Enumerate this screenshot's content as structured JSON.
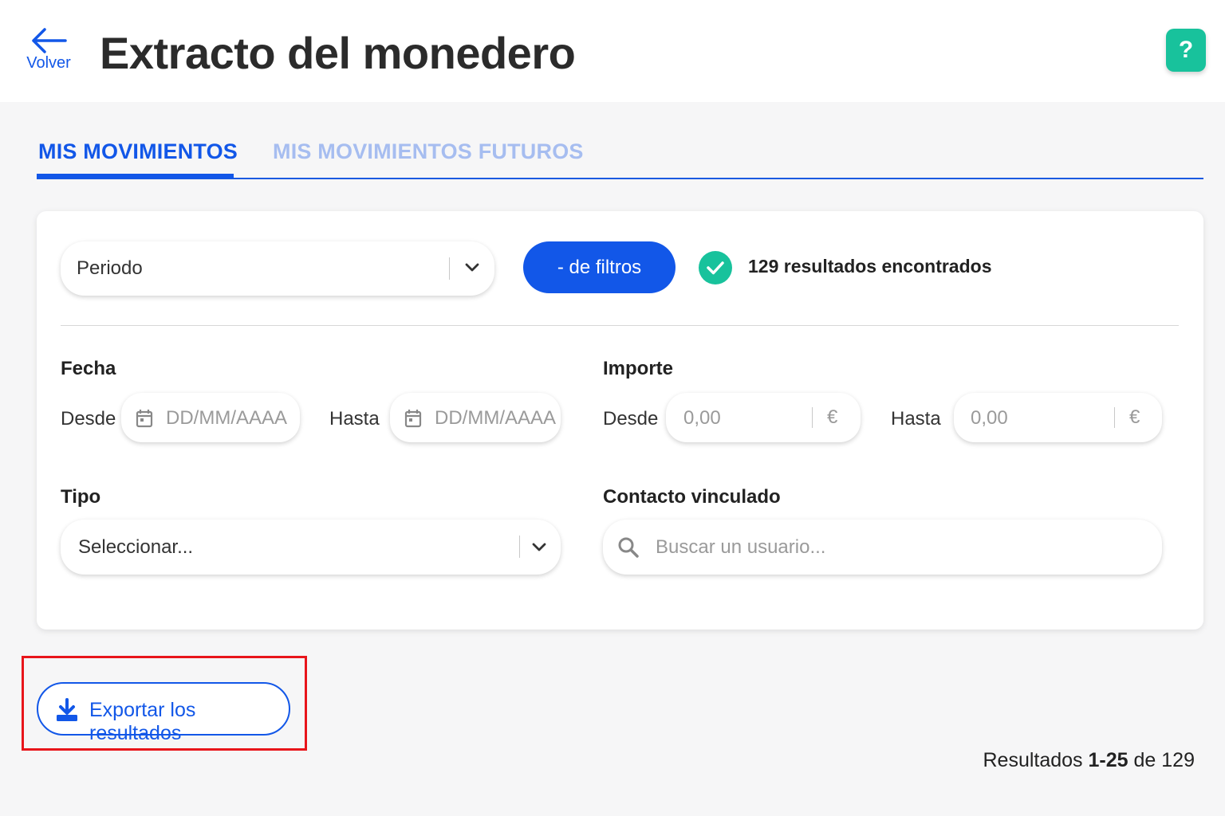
{
  "header": {
    "back_label": "Volver",
    "title": "Extracto del monedero",
    "help_symbol": "?"
  },
  "tabs": [
    {
      "label": "MIS MOVIMIENTOS",
      "active": true
    },
    {
      "label": "MIS MOVIMIENTOS FUTUROS",
      "active": false
    }
  ],
  "filters": {
    "period_value": "Periodo",
    "filters_button": "- de filtros",
    "results_found": "129 resultados encontrados",
    "date": {
      "label": "Fecha",
      "from_label": "Desde",
      "from_placeholder": "DD/MM/AAAA",
      "to_label": "Hasta",
      "to_placeholder": "DD/MM/AAAA"
    },
    "amount": {
      "label": "Importe",
      "from_label": "Desde",
      "from_placeholder": "0,00",
      "to_label": "Hasta",
      "to_placeholder": "0,00",
      "currency": "€"
    },
    "type": {
      "label": "Tipo",
      "value": "Seleccionar..."
    },
    "contact": {
      "label": "Contacto vinculado",
      "placeholder": "Buscar un usuario..."
    }
  },
  "export_button": "Exportar los resultados",
  "pagination": {
    "prefix": "Resultados",
    "range": "1-25",
    "of": "de",
    "total": "129"
  },
  "colors": {
    "primary": "#1257e8",
    "success": "#18c29c",
    "highlight": "#e8151b",
    "inactive_tab": "#a6bdf0"
  }
}
